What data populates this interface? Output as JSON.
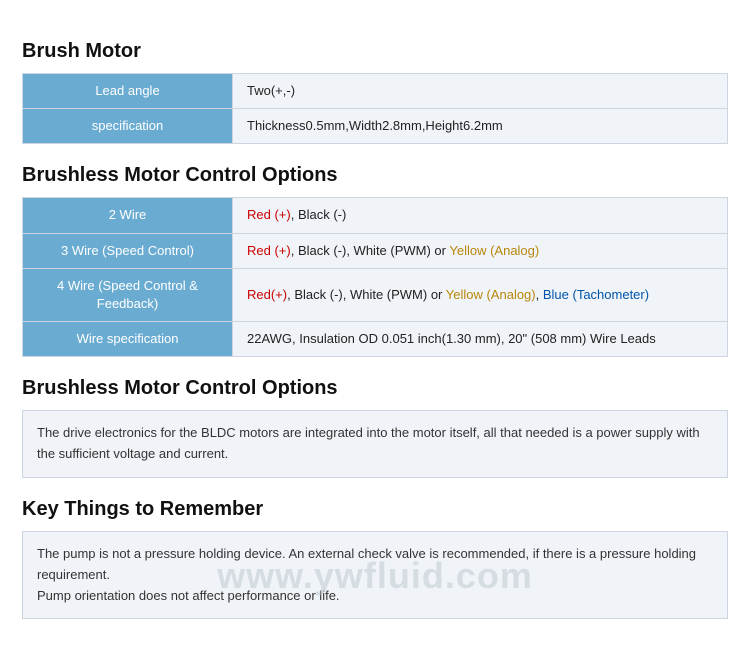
{
  "sections": [
    {
      "id": "brush-motor",
      "title": "Brush Motor",
      "type": "table",
      "rows": [
        {
          "label": "Lead angle",
          "value": "Two(+,-)"
        },
        {
          "label": "specification",
          "value": "Thickness0.5mm,Width2.8mm,Height6.2mm"
        }
      ]
    },
    {
      "id": "brushless-control-options",
      "title": "Brushless Motor Control Options",
      "type": "table",
      "rows": [
        {
          "label": "2 Wire",
          "value": "Red (+), Black (-)"
        },
        {
          "label": "3 Wire (Speed Control)",
          "value": "Red (+), Black (-), White (PWM) or Yellow (Analog)"
        },
        {
          "label": "4 Wire (Speed Control & Feedback)",
          "value": "Red(+), Black (-), White (PWM) or Yellow (Analog), Blue (Tachometer)"
        },
        {
          "label": "Wire specification",
          "value": "22AWG, Insulation OD 0.051 inch(1.30 mm), 20\" (508 mm) Wire Leads"
        }
      ]
    },
    {
      "id": "brushless-control-description",
      "title": "Brushless Motor Control Options",
      "type": "description",
      "text": "The drive electronics for the BLDC motors are integrated into the motor itself, all that needed is a power supply with the sufficient voltage and current."
    },
    {
      "id": "key-things",
      "title": "Key Things to Remember",
      "type": "description",
      "lines": [
        "The pump is not a pressure holding device. An external check valve is recommended, if there is a pressure holding requirement.",
        "Pump orientation does not affect performance or life."
      ]
    }
  ],
  "watermark": "www.ywfluid.com"
}
